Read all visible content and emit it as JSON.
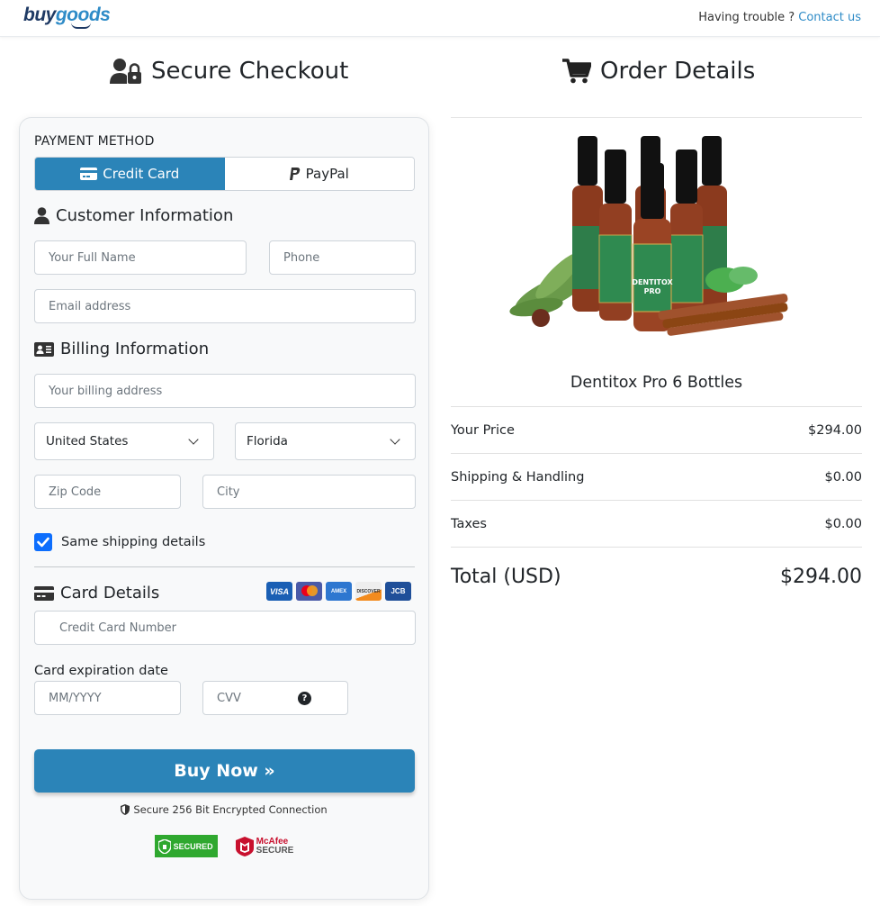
{
  "header": {
    "logo_part1": "buy",
    "logo_part2": "goods",
    "trouble_text": "Having trouble ?",
    "contact_link": "Contact us"
  },
  "checkout": {
    "title": "Secure Checkout",
    "payment_method_label": "PAYMENT METHOD",
    "tabs": [
      {
        "label": "Credit Card",
        "icon": "credit-card-icon",
        "active": true
      },
      {
        "label": "PayPal",
        "icon": "paypal-icon",
        "active": false
      }
    ],
    "customer": {
      "heading": "Customer Information",
      "full_name_placeholder": "Your Full Name",
      "phone_placeholder": "Phone",
      "email_placeholder": "Email address"
    },
    "billing": {
      "heading": "Billing Information",
      "address_placeholder": "Your billing address",
      "country_selected": "United States",
      "state_selected": "Florida",
      "zip_placeholder": "Zip Code",
      "city_placeholder": "City",
      "same_shipping_label": "Same shipping details",
      "same_shipping_checked": true
    },
    "card": {
      "heading": "Card Details",
      "accepted_cards": [
        "VISA",
        "Mastercard",
        "AMEX",
        "DISCOVER",
        "JCB"
      ],
      "number_placeholder": "Credit Card Number",
      "expiration_label": "Card expiration date",
      "expiry_placeholder": "MM/YYYY",
      "cvv_placeholder": "CVV"
    },
    "buy_button": "Buy Now »",
    "secure_text": "Secure 256 Bit Encrypted Connection",
    "badges": {
      "trustguard": "SECURED",
      "mcafee_top": "McAfee",
      "mcafee_bottom": "SECURE"
    }
  },
  "order": {
    "title": "Order Details",
    "product_name": "Dentitox Pro 6 Bottles",
    "lines": [
      {
        "label": "Your Price",
        "value": "$294.00"
      },
      {
        "label": "Shipping & Handling",
        "value": "$0.00"
      },
      {
        "label": "Taxes",
        "value": "$0.00"
      }
    ],
    "total_label": "Total (USD)",
    "total_value": "$294.00"
  },
  "colors": {
    "primary": "#2b84b8",
    "checkbox": "#0d6efd",
    "link": "#2e8bc7"
  }
}
